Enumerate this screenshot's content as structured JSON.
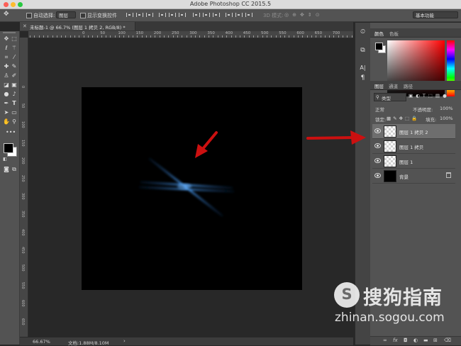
{
  "window": {
    "title": "Adobe Photoshop CC 2015.5",
    "workspace": "基本功能"
  },
  "options_bar": {
    "auto_select_label": "自动选择:",
    "auto_select_value": "图层",
    "show_transform_label": "显示变换控件",
    "mode_3d_label": "3D 模式:"
  },
  "document": {
    "tab_title": "未标题-1 @ 66.7% (图层 1 拷贝 2, RGB/8) *",
    "ruler_marks": [
      "0",
      "50",
      "100",
      "150",
      "200",
      "250",
      "300",
      "350",
      "400",
      "450",
      "500",
      "550",
      "600",
      "650",
      "700",
      "750",
      "800"
    ]
  },
  "status_bar": {
    "zoom": "66.67%",
    "doc_size": "文档:1.88M/8.10M"
  },
  "color_panel": {
    "tabs": [
      "颜色",
      "色板"
    ],
    "foreground": "#000000",
    "background": "#ffffff"
  },
  "layers_panel": {
    "tabs": [
      "图层",
      "通道",
      "路径"
    ],
    "filter_kind": "类型",
    "blend_mode": "正常",
    "opacity_label": "不透明度:",
    "opacity_value": "100%",
    "lock_label": "锁定:",
    "fill_label": "填充:",
    "fill_value": "100%",
    "layers": [
      {
        "name": "图层 1 拷贝 2",
        "selected": true,
        "kind": "transparent"
      },
      {
        "name": "图层 1 拷贝",
        "selected": false,
        "kind": "transparent"
      },
      {
        "name": "图层 1",
        "selected": false,
        "kind": "transparent"
      },
      {
        "name": "背景",
        "selected": false,
        "kind": "black",
        "locked": true
      }
    ],
    "footer_icons": [
      "link-icon",
      "fx-icon",
      "mask-icon",
      "adjustment-icon",
      "group-icon",
      "new-layer-icon",
      "trash-icon"
    ]
  },
  "colors": {
    "annotation_arrow": "#cc1010",
    "streak_blue": "#2f7fd8"
  },
  "watermark": {
    "brand": "搜狗指南",
    "url": "zhinan.sogou.com"
  }
}
